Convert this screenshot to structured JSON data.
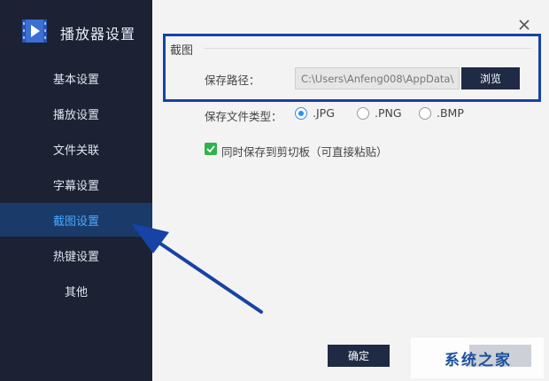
{
  "app": {
    "title": "播放器设置"
  },
  "sidebar": {
    "items": [
      {
        "label": "基本设置"
      },
      {
        "label": "播放设置"
      },
      {
        "label": "文件关联"
      },
      {
        "label": "字幕设置"
      },
      {
        "label": "截图设置"
      },
      {
        "label": "热键设置"
      },
      {
        "label": "其他"
      }
    ],
    "active": "截图设置"
  },
  "screenshot": {
    "section_title": "截图",
    "path_label": "保存路径：",
    "path_value": "C:\\Users\\Anfeng008\\AppData\\",
    "browse_label": "浏览",
    "type_label": "保存文件类型：",
    "file_types": [
      {
        "label": ".JPG",
        "checked": true
      },
      {
        "label": ".PNG",
        "checked": false
      },
      {
        "label": ".BMP",
        "checked": false
      }
    ],
    "clipboard_label": "同时保存到剪切板（可直接粘贴）",
    "clipboard_checked": true
  },
  "footer": {
    "ok_label": "确定"
  },
  "watermark": {
    "text": "系统之家"
  },
  "colors": {
    "sidebar_bg": "#1c2233",
    "active_item_bg": "#1a3a6a",
    "active_item_text": "#48a9ff",
    "button_bg": "#1f2a44",
    "highlight": "#1742a6",
    "check_green": "#2fb34a",
    "radio_blue": "#2e8fe6"
  }
}
